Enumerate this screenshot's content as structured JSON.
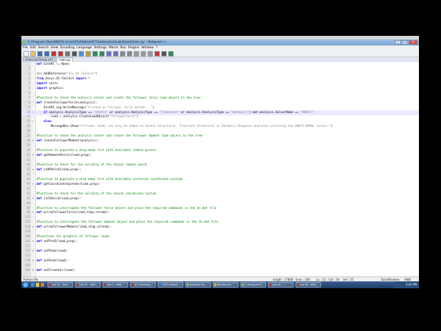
{
  "window": {
    "title": "C:\\Program Files\\ANSYS Inc\\v145\\Addins\\ACT\\extensions\\Lab4\\load\\main.py - Notepad++",
    "controls": [
      "_",
      "□",
      "x"
    ]
  },
  "menu": [
    "File",
    "Edit",
    "Search",
    "View",
    "Encoding",
    "Language",
    "Settings",
    "Macro",
    "Run",
    "Plugins",
    "Window",
    "?"
  ],
  "toolbar_icons": [
    {
      "name": "new-icon",
      "color": "#f4f4f4"
    },
    {
      "name": "open-icon",
      "color": "#e9c46a"
    },
    {
      "name": "save-icon",
      "color": "#3a6fb0"
    },
    {
      "name": "save-all-icon",
      "color": "#3a6fb0"
    },
    {
      "name": "close-icon",
      "color": "#c0392b"
    },
    {
      "name": "close-all-icon",
      "color": "#c0392b"
    },
    {
      "name": "print-icon",
      "color": "#777777"
    },
    {
      "name": "cut-icon",
      "color": "#555555"
    },
    {
      "name": "copy-icon",
      "color": "#4a90d9"
    },
    {
      "name": "paste-icon",
      "color": "#c49a3a"
    },
    {
      "name": "undo-icon",
      "color": "#2e8b57"
    },
    {
      "name": "redo-icon",
      "color": "#2e8b57"
    },
    {
      "name": "find-icon",
      "color": "#6f6fbf"
    },
    {
      "name": "replace-icon",
      "color": "#6f6fbf"
    },
    {
      "name": "zoom-in-icon",
      "color": "#888888"
    },
    {
      "name": "zoom-out-icon",
      "color": "#888888"
    },
    {
      "name": "sync-icon",
      "color": "#999999"
    },
    {
      "name": "wrap-icon",
      "color": "#999999"
    },
    {
      "name": "indent-guide-icon",
      "color": "#999999"
    },
    {
      "name": "macro-record-icon",
      "color": "#cc3333"
    },
    {
      "name": "macro-stop-icon",
      "color": "#555555"
    },
    {
      "name": "macro-play-icon",
      "color": "#2e8b57"
    }
  ],
  "tabs": [
    {
      "label": "ExtensionSetup.xml",
      "active": false
    },
    {
      "label": "main.py",
      "active": true
    }
  ],
  "lines": [
    {
      "n": "",
      "fold": "",
      "code": [
        {
          "t": "def",
          "c": "c-kw"
        },
        {
          "t": " ExtAPI != None:",
          "c": ""
        }
      ],
      "partial": true
    },
    {
      "n": "1",
      "fold": "",
      "code": []
    },
    {
      "n": "2",
      "fold": "",
      "code": [
        {
          "t": "clr.AddReference(",
          "c": ""
        },
        {
          "t": "\"Ans.UI.Toolkit\"",
          "c": "c-str"
        },
        {
          "t": ")",
          "c": ""
        }
      ]
    },
    {
      "n": "3",
      "fold": "",
      "code": [
        {
          "t": "from",
          "c": "c-kw"
        },
        {
          "t": " Ansys.UI.Toolkit ",
          "c": ""
        },
        {
          "t": "import",
          "c": "c-kw"
        },
        {
          "t": " *",
          "c": ""
        }
      ]
    },
    {
      "n": "4",
      "fold": "",
      "code": [
        {
          "t": "import",
          "c": "c-kw"
        },
        {
          "t": " units",
          "c": ""
        }
      ]
    },
    {
      "n": "5",
      "fold": "",
      "code": [
        {
          "t": "import",
          "c": "c-kw"
        },
        {
          "t": " graphics",
          "c": ""
        }
      ]
    },
    {
      "n": "6",
      "fold": "",
      "code": []
    },
    {
      "n": "7",
      "fold": "",
      "code": [
        {
          "t": "#Function to check the analysis solver and create the follower force load object in the tree",
          "c": "c-com"
        }
      ]
    },
    {
      "n": "8",
      "fold": "−",
      "code": [
        {
          "t": "def",
          "c": "c-def"
        },
        {
          "t": " createFollowerForce",
          "c": "c-fn"
        },
        {
          "t": "(analysis):",
          "c": ""
        }
      ]
    },
    {
      "n": "9",
      "fold": "",
      "code": [
        {
          "t": "    ExtAPI.Log.WriteMessage(",
          "c": ""
        },
        {
          "t": "\"Clicked on follower force button...\"",
          "c": "c-str"
        },
        {
          "t": ")",
          "c": ""
        }
      ]
    },
    {
      "n": "10",
      "fold": "−",
      "code": [
        {
          "t": "    if",
          "c": "c-kw"
        },
        {
          "t": " analysis.AnalysisType == ",
          "c": ""
        },
        {
          "t": "\"Static\"",
          "c": "c-str"
        },
        {
          "t": " or analysis.AnalysisType == ",
          "c": ""
        },
        {
          "t": "\"Transient\"",
          "c": "c-str"
        },
        {
          "t": " or analysis.AnalysisType == ",
          "c": ""
        },
        {
          "t": "\"Harmonic\"",
          "c": "c-str"
        },
        {
          "t": ") and analysis.SolverName == ",
          "c": ""
        },
        {
          "t": "\"ANSYS\"",
          "c": "c-str"
        },
        {
          "t": ":",
          "c": ""
        }
      ],
      "hl": true
    },
    {
      "n": "11",
      "fold": "",
      "code": [
        {
          "t": "        load = analysis.CreateLoadObject(",
          "c": ""
        },
        {
          "t": "\"FollowerForce\"",
          "c": "c-str"
        },
        {
          "t": ")",
          "c": ""
        }
      ]
    },
    {
      "n": "12",
      "fold": "−",
      "code": [
        {
          "t": "    else:",
          "c": "c-kw"
        }
      ]
    },
    {
      "n": "13",
      "fold": "",
      "code": [
        {
          "t": "        MessageBox.Show(",
          "c": ""
        },
        {
          "t": "\"Follower loads can only be added to Static Structural, Transient Structural or Harmonic Response analyses utilizing the ANSYS MAPDL solver.\"",
          "c": "c-str"
        },
        {
          "t": ")",
          "c": ""
        }
      ]
    },
    {
      "n": "14",
      "fold": "",
      "code": []
    },
    {
      "n": "15",
      "fold": "",
      "code": [
        {
          "t": "#Function to check the analysis solver and create the follower moment load object in the tree",
          "c": "c-com"
        }
      ]
    },
    {
      "n": "16",
      "fold": "+",
      "code": [
        {
          "t": "def",
          "c": "c-def"
        },
        {
          "t": " createFollowerMoment",
          "c": "c-fn"
        },
        {
          "t": "(analysis):",
          "c": ""
        }
      ]
    },
    {
      "n": "25",
      "fold": "",
      "code": []
    },
    {
      "n": "26",
      "fold": "",
      "code": [
        {
          "t": "#Function to populate a drop-down list with available remote points",
          "c": "c-com"
        }
      ]
    },
    {
      "n": "27",
      "fold": "+",
      "code": [
        {
          "t": "def",
          "c": "c-def"
        },
        {
          "t": " getRemotePoints",
          "c": "c-fn"
        },
        {
          "t": "(load,prop):",
          "c": ""
        }
      ]
    },
    {
      "n": "33",
      "fold": "",
      "code": []
    },
    {
      "n": "34",
      "fold": "",
      "code": [
        {
          "t": "#Function to check for the validity of the chosen remote point",
          "c": "c-com"
        }
      ]
    },
    {
      "n": "35",
      "fold": "+",
      "code": [
        {
          "t": "def",
          "c": "c-def"
        },
        {
          "t": " isRPValid",
          "c": "c-fn"
        },
        {
          "t": "(load,prop):",
          "c": ""
        }
      ]
    },
    {
      "n": "43",
      "fold": "",
      "code": []
    },
    {
      "n": "44",
      "fold": "",
      "code": [
        {
          "t": "#Function to populate a drop-down list with available cartesian coordinate systems",
          "c": "c-com"
        }
      ]
    },
    {
      "n": "45",
      "fold": "+",
      "code": [
        {
          "t": "def",
          "c": "c-def"
        },
        {
          "t": " getCoordinateSystems",
          "c": "c-fn"
        },
        {
          "t": "(load,prop):",
          "c": ""
        }
      ]
    },
    {
      "n": "53",
      "fold": "",
      "code": []
    },
    {
      "n": "54",
      "fold": "",
      "code": [
        {
          "t": "#Function to check for the validity of the chosen coordinate system",
          "c": "c-com"
        }
      ]
    },
    {
      "n": "55",
      "fold": "+",
      "code": [
        {
          "t": "def",
          "c": "c-def"
        },
        {
          "t": " isCSValid",
          "c": "c-fn"
        },
        {
          "t": "(load,prop):",
          "c": ""
        }
      ]
    },
    {
      "n": "64",
      "fold": "",
      "code": []
    },
    {
      "n": "65",
      "fold": "",
      "code": [
        {
          "t": "#Function to interrogate the follower force object and place the required commands in the ds.dat file",
          "c": "c-com"
        }
      ]
    },
    {
      "n": "66",
      "fold": "+",
      "code": [
        {
          "t": "def",
          "c": "c-def"
        },
        {
          "t": " writeFollowerForce",
          "c": "c-fn"
        },
        {
          "t": "(load,step,stream):",
          "c": ""
        }
      ]
    },
    {
      "n": "112",
      "fold": "",
      "code": []
    },
    {
      "n": "113",
      "fold": "",
      "code": [
        {
          "t": "#Function to interrogate the follower moment object and place the required commands in the ds.dat file",
          "c": "c-com"
        }
      ]
    },
    {
      "n": "114",
      "fold": "+",
      "code": [
        {
          "t": "def",
          "c": "c-def"
        },
        {
          "t": " writeFollowerMoment",
          "c": "c-fn"
        },
        {
          "t": "(load,step,stream):",
          "c": ""
        }
      ]
    },
    {
      "n": "159",
      "fold": "",
      "code": []
    },
    {
      "n": "160",
      "fold": "",
      "code": [
        {
          "t": "#Functions for graphics of follower loads",
          "c": "c-com"
        }
      ]
    },
    {
      "n": "161",
      "fold": "+",
      "code": [
        {
          "t": "def",
          "c": "c-def"
        },
        {
          "t": " onFPreS",
          "c": "c-fn"
        },
        {
          "t": "(load,prop):",
          "c": ""
        }
      ]
    },
    {
      "n": "172",
      "fold": "",
      "code": []
    },
    {
      "n": "173",
      "fold": "+",
      "code": [
        {
          "t": "def",
          "c": "c-def"
        },
        {
          "t": " onFHide",
          "c": "c-fn"
        },
        {
          "t": "(load):",
          "c": ""
        }
      ]
    },
    {
      "n": "177",
      "fold": "",
      "code": []
    },
    {
      "n": "178",
      "fold": "+",
      "code": [
        {
          "t": "def",
          "c": "c-def"
        },
        {
          "t": " onFHide",
          "c": "c-fn"
        },
        {
          "t": "(load):",
          "c": ""
        }
      ]
    },
    {
      "n": "182",
      "fold": "",
      "code": []
    },
    {
      "n": "183",
      "fold": "+",
      "code": [
        {
          "t": "def",
          "c": "c-def"
        },
        {
          "t": " onFCreateGr",
          "c": "c-fn"
        },
        {
          "t": "(load):",
          "c": ""
        }
      ]
    }
  ],
  "status": {
    "file_type": "Python file",
    "length": "length : 17806",
    "lines": "lines : 338",
    "ln": "Ln : 15",
    "col": "Col : 34",
    "sel": "Sel : 25",
    "eol": "Dos\\Windows",
    "encoding": "ANSI"
  },
  "taskbar": {
    "quick_launch": [
      {
        "name": "ie-icon",
        "color": "#3b8fe0"
      },
      {
        "name": "explorer-icon",
        "color": "#e8c24a"
      },
      {
        "name": "media-icon",
        "color": "#e07a2a"
      }
    ],
    "buttons": [
      {
        "label": "Lab 01 - ANS...",
        "color": "#c0392b"
      },
      {
        "label": "Lab 01 - ANS...",
        "color": "#c0392b"
      },
      {
        "label": "Lab 2 - ANS...",
        "color": "#c0392b"
      },
      {
        "label": "ACT Develop...",
        "color": "#c0392b"
      },
      {
        "label": "VSCO MobiCI...",
        "color": "#2e7bd6"
      },
      {
        "label": "Notepad Pro...",
        "color": "#8bc34a"
      },
      {
        "label": "Workbench...",
        "color": "#f1c40f"
      },
      {
        "label": "C:\\Program Fi...",
        "color": "#8bc34a"
      },
      {
        "label": "Lab 02 ...",
        "color": "#c0392b"
      },
      {
        "label": "Lab 02 - ANS...",
        "color": "#c0392b"
      }
    ],
    "clock": "2:41 PM"
  }
}
